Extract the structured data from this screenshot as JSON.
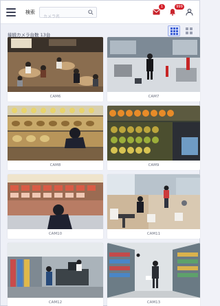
{
  "header": {
    "search_label": "検索",
    "search_placeholder": "カメラ名",
    "notification_badge": "1",
    "alert_badge": "999"
  },
  "main": {
    "camera_count": "接続カメラ台数 13台"
  },
  "cameras": [
    {
      "name": "CAM6"
    },
    {
      "name": "CAM7"
    },
    {
      "name": "CAM8"
    },
    {
      "name": "CAM9"
    },
    {
      "name": "CAM10"
    },
    {
      "name": "CAM11"
    },
    {
      "name": "CAM12"
    },
    {
      "name": "CAM13"
    }
  ],
  "icons": {
    "menu": "menu-icon",
    "search": "search-icon",
    "notification": "envelope-icon",
    "alert": "bell-icon",
    "user": "user-icon",
    "grid_view": "grid-view-icon",
    "list_view": "list-view-icon"
  },
  "colors": {
    "accent": "#3d5fd6",
    "badge": "#d4202a",
    "background": "#eef0f7"
  }
}
